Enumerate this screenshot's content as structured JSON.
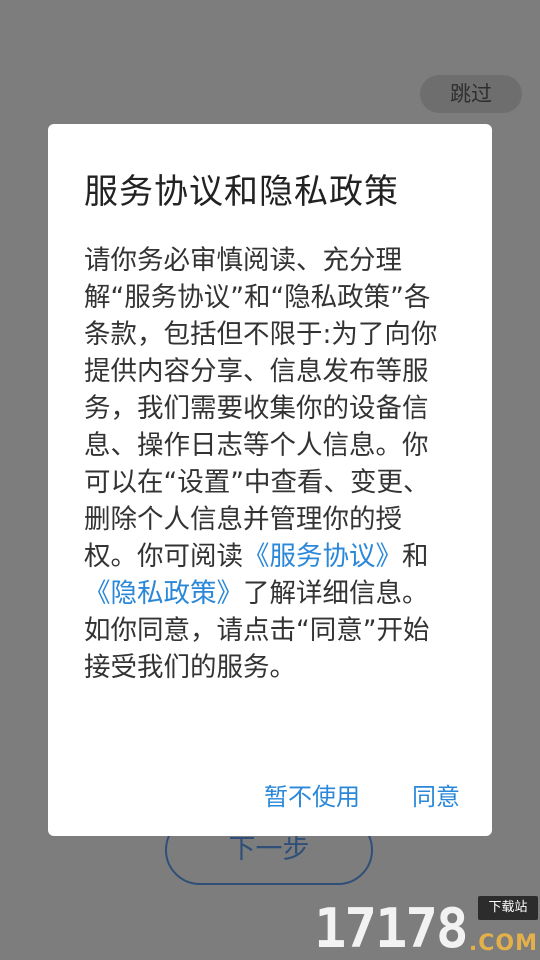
{
  "background_screen": {
    "skip_label": "跳过",
    "next_label": "下一步"
  },
  "dialog": {
    "title": "服务协议和隐私政策",
    "body_part1": "请你务必审慎阅读、充分理解“服务协议”和“隐私政策”各条款，包括但不限于:为了向你提供内容分享、信息发布等服务，我们需要收集你的设备信息、操作日志等个人信息。你可以在“设置”中查看、变更、删除个人信息并管理你的授权。你可阅读",
    "link_service": "《服务协议》",
    "body_and": "和",
    "link_privacy": "《隐私政策》",
    "body_part2": "了解详细信息。如你同意，请点击“同意”开始接受我们的服务。",
    "decline_label": "暂不使用",
    "agree_label": "同意"
  },
  "watermark": {
    "number": "17178",
    "download_label": "下载站",
    "domain": ".COM"
  },
  "colors": {
    "overlay": "#7d7d7d",
    "link_blue": "#2b88d8",
    "dialog_bg": "#ffffff",
    "next_button_border": "#2f4f78"
  }
}
